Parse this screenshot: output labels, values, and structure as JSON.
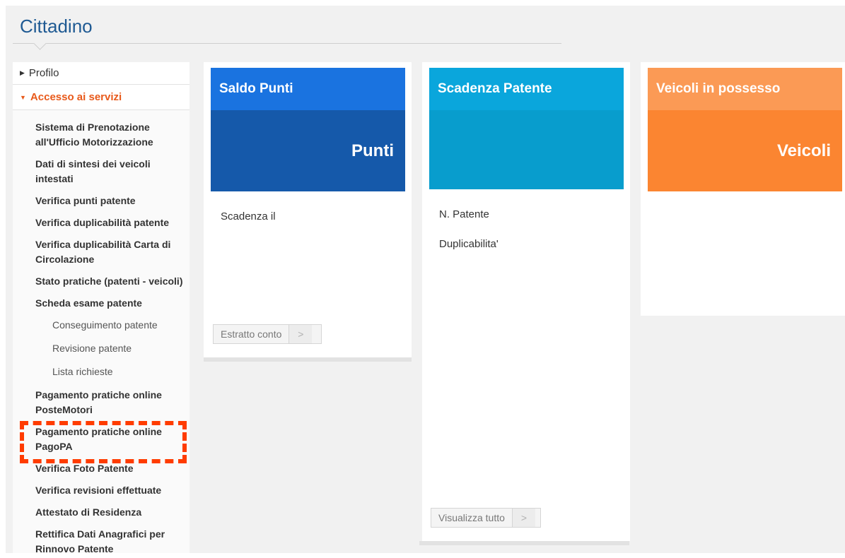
{
  "page": {
    "title": "Cittadino"
  },
  "sidebar": {
    "profilo": "Profilo",
    "accesso": "Accesso ai servizi",
    "items": [
      "Sistema di Prenotazione all'Ufficio Motorizzazione",
      "Dati di sintesi dei veicoli intestati",
      "Verifica punti patente",
      "Verifica duplicabilità patente",
      "Verifica duplicabilità Carta di Circolazione",
      "Stato pratiche (patenti - veicoli)",
      "Scheda esame patente",
      "Conseguimento patente",
      "Revisione patente",
      "Lista richieste",
      "Pagamento pratiche online PosteMotori",
      "Pagamento pratiche online PagoPA",
      "Verifica Foto Patente",
      "Verifica revisioni effettuate",
      "Attestato di Residenza",
      "Rettifica Dati Anagrafici per Rinnovo Patente"
    ]
  },
  "cards": {
    "saldo": {
      "title": "Saldo Punti",
      "big": "Punti",
      "text1": "Scadenza il",
      "button": "Estratto conto",
      "color_top": "#1a73e0",
      "color_bottom": "#1559aa"
    },
    "scadenza": {
      "title": "Scadenza Patente",
      "text1": "N. Patente",
      "text2": "Duplicabilita'",
      "button": "Visualizza tutto",
      "color_top": "#0aa6dc",
      "color_bottom": "#089dcd"
    },
    "veicoli": {
      "title": "Veicoli in possesso",
      "big": "Veicoli",
      "color_top": "#fb9a55",
      "color_bottom": "#fb8531"
    }
  },
  "icons": {
    "expand": "triangle-right-icon",
    "collapse": "triangle-down-icon",
    "arrow": "chevron-right-icon"
  },
  "colors": {
    "title": "#1f5a93",
    "accent": "#e8591a",
    "highlight": "#ff3c00"
  }
}
